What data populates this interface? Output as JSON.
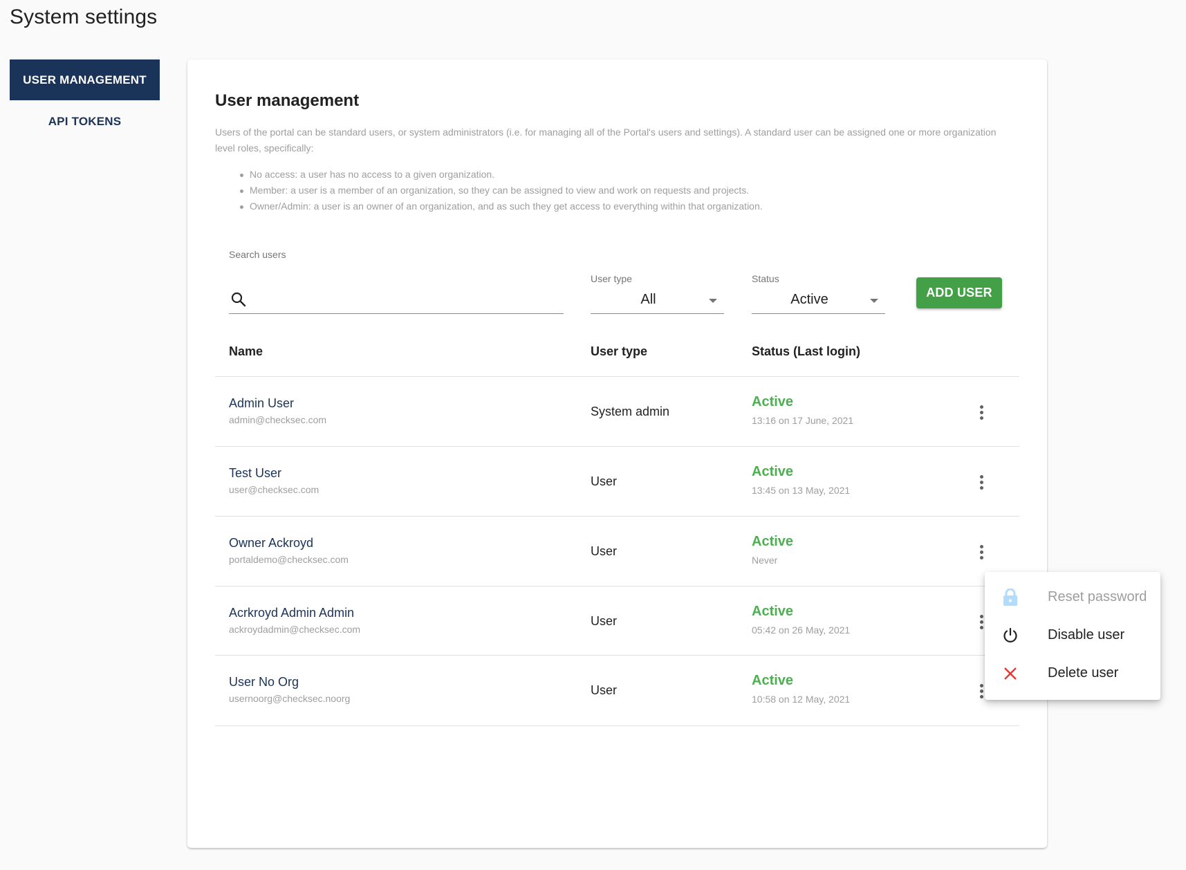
{
  "page": {
    "title": "System settings"
  },
  "sidebar": {
    "items": [
      {
        "label": "USER MANAGEMENT",
        "active": true
      },
      {
        "label": "API TOKENS",
        "active": false
      }
    ]
  },
  "card": {
    "title": "User management",
    "description": "Users of the portal can be standard users, or system administrators (i.e. for managing all of the Portal's users and settings). A standard user can be assigned one or more organization level roles, specifically:",
    "bullets": [
      "No access: a user has no access to a given organization.",
      "Member: a user is a member of an organization, so they can be assigned to view and work on requests and projects.",
      "Owner/Admin: a user is an owner of an organization, and as such they get access to everything within that organization."
    ]
  },
  "filters": {
    "search": {
      "label": "Search users",
      "value": "",
      "placeholder": ""
    },
    "user_type": {
      "label": "User type",
      "value": "All"
    },
    "status": {
      "label": "Status",
      "value": "Active"
    },
    "add_user_label": "ADD USER"
  },
  "table": {
    "columns": [
      "Name",
      "User type",
      "Status (Last login)"
    ],
    "rows": [
      {
        "name": "Admin User",
        "email": "admin@checksec.com",
        "user_type": "System admin",
        "status": "Active",
        "last_login": "13:16 on 17 June, 2021"
      },
      {
        "name": "Test User",
        "email": "user@checksec.com",
        "user_type": "User",
        "status": "Active",
        "last_login": "13:45 on 13 May, 2021"
      },
      {
        "name": "Owner Ackroyd",
        "email": "portaldemo@checksec.com",
        "user_type": "User",
        "status": "Active",
        "last_login": "Never"
      },
      {
        "name": "Acrkroyd Admin Admin",
        "email": "ackroydadmin@checksec.com",
        "user_type": "User",
        "status": "Active",
        "last_login": "05:42 on 26 May, 2021"
      },
      {
        "name": "User No Org",
        "email": "usernoorg@checksec.noorg",
        "user_type": "User",
        "status": "Active",
        "last_login": "10:58 on 12 May, 2021"
      }
    ]
  },
  "context_menu": {
    "items": [
      {
        "label": "Reset password",
        "icon": "lock-icon",
        "disabled": true
      },
      {
        "label": "Disable user",
        "icon": "power-icon",
        "disabled": false
      },
      {
        "label": "Delete user",
        "icon": "close-icon",
        "disabled": false
      }
    ]
  },
  "colors": {
    "brand_navy": "#1a3358",
    "accent_green": "#43a047",
    "status_active": "#4caf50",
    "delete_red": "#e53935",
    "lock_disabled": "#b3dbfb"
  }
}
